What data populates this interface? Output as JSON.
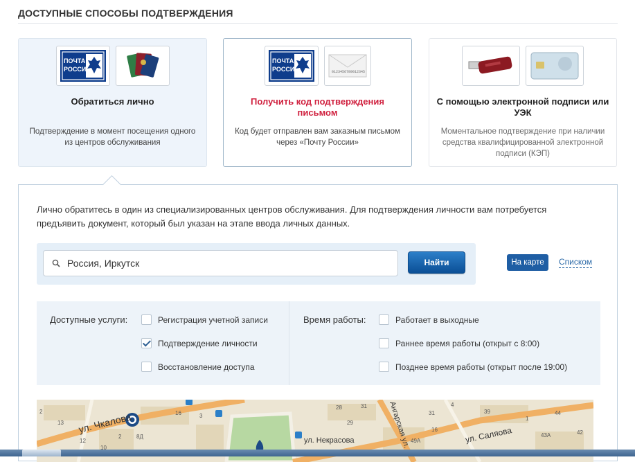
{
  "section_title": "ДОСТУПНЫЕ СПОСОБЫ ПОДТВЕРЖДЕНИЯ",
  "cards": [
    {
      "title": "Обратиться лично",
      "desc": "Подтверждение в момент посещения одного из центров обслуживания",
      "logo_lines": [
        "ПОЧТА",
        "РОССИИ"
      ]
    },
    {
      "title": "Получить код подтверждения письмом",
      "desc": "Код будет отправлен вам заказным письмом через «Почту России»",
      "logo_lines": [
        "ПОЧТА",
        "РОССИИ"
      ],
      "envelope_code": "0123456789012345"
    },
    {
      "title": "С помощью электронной подписи или УЭК",
      "desc": "Моментальное подтверждение при наличии средства квалифицированной электронной подписи (КЭП)"
    }
  ],
  "intro": "Лично обратитесь в один из специализированных центров обслуживания. Для подтверждения личности вам потребуется предъявить документ, который был указан на этапе ввода личных данных.",
  "search": {
    "value": "Россия, Иркутск",
    "button": "Найти"
  },
  "view": {
    "map": "На карте",
    "list": "Списком"
  },
  "filters": {
    "services_label": "Доступные услуги:",
    "services": [
      {
        "label": "Регистрация учетной записи",
        "checked": false
      },
      {
        "label": "Подтверждение личности",
        "checked": true
      },
      {
        "label": "Восстановление доступа",
        "checked": false
      }
    ],
    "hours_label": "Время работы:",
    "hours": [
      {
        "label": "Работает в выходные",
        "checked": false
      },
      {
        "label": "Раннее время работы (открыт с 8:00)",
        "checked": false
      },
      {
        "label": "Позднее время работы (открыт после 19:00)",
        "checked": false
      }
    ]
  },
  "map": {
    "streets": [
      "ул. Чкалова",
      "ул. Некрасова",
      "ул. Саляова",
      "Ангарская ул."
    ],
    "house_numbers": [
      "2",
      "13",
      "10",
      "12",
      "2",
      "8Д",
      "16",
      "3",
      "29",
      "31",
      "28",
      "49А",
      "31",
      "16",
      "4",
      "39",
      "1",
      "43А",
      "44",
      "42"
    ]
  },
  "colors": {
    "accent": "#1f5ea4",
    "title_red": "#d0213f",
    "panel_bg": "#edf3f9"
  }
}
